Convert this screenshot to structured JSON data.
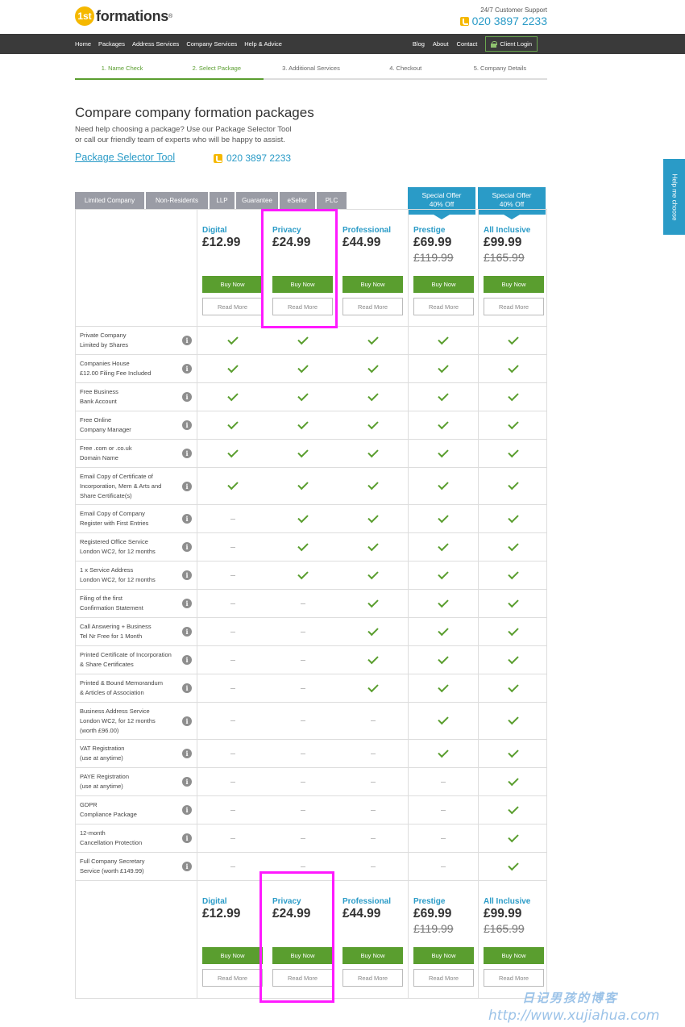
{
  "header": {
    "logo_mark": "1st",
    "logo_text": "formations",
    "logo_reg": "®",
    "support_label": "24/7 Customer Support",
    "support_phone": "020 3897 2233"
  },
  "nav": {
    "left": [
      "Home",
      "Packages",
      "Address Services",
      "Company Services",
      "Help & Advice"
    ],
    "right": [
      "Blog",
      "About",
      "Contact"
    ],
    "client_login": "Client Login"
  },
  "steps": [
    {
      "label": "1. Name Check",
      "done": true
    },
    {
      "label": "2. Select Package",
      "done": true
    },
    {
      "label": "3. Additional Services",
      "done": false
    },
    {
      "label": "4. Checkout",
      "done": false
    },
    {
      "label": "5. Company Details",
      "done": false
    }
  ],
  "intro": {
    "title": "Compare company formation packages",
    "line1": "Need help choosing a package? Use our Package Selector Tool",
    "line2": "or call our friendly team of experts who will be happy to assist.",
    "selector_link": "Package Selector Tool",
    "phone": "020 3897 2233"
  },
  "tabs": [
    "Limited Company",
    "Non-Residents",
    "LLP",
    "Guarantee",
    "eSeller",
    "PLC"
  ],
  "offer": {
    "line1": "Special Offer",
    "line2": "40% Off"
  },
  "packages": [
    {
      "name": "Digital",
      "price": "£12.99",
      "old_price": "",
      "buy": "Buy Now",
      "more": "Read More"
    },
    {
      "name": "Privacy",
      "price": "£24.99",
      "old_price": "",
      "buy": "Buy Now",
      "more": "Read More"
    },
    {
      "name": "Professional",
      "price": "£44.99",
      "old_price": "",
      "buy": "Buy Now",
      "more": "Read More"
    },
    {
      "name": "Prestige",
      "price": "£69.99",
      "old_price": "£119.99",
      "buy": "Buy Now",
      "more": "Read More"
    },
    {
      "name": "All Inclusive",
      "price": "£99.99",
      "old_price": "£165.99",
      "buy": "Buy Now",
      "more": "Read More"
    }
  ],
  "features": [
    {
      "lines": [
        "Private Company",
        "Limited by Shares"
      ],
      "marks": [
        1,
        1,
        1,
        1,
        1
      ]
    },
    {
      "lines": [
        "Companies House",
        "£12.00 Filing Fee Included"
      ],
      "marks": [
        1,
        1,
        1,
        1,
        1
      ]
    },
    {
      "lines": [
        "Free Business",
        "Bank Account"
      ],
      "marks": [
        1,
        1,
        1,
        1,
        1
      ]
    },
    {
      "lines": [
        "Free Online",
        "Company Manager"
      ],
      "marks": [
        1,
        1,
        1,
        1,
        1
      ]
    },
    {
      "lines": [
        "Free .com or .co.uk",
        "Domain Name"
      ],
      "marks": [
        1,
        1,
        1,
        1,
        1
      ]
    },
    {
      "lines": [
        "Email Copy of Certificate of",
        "Incorporation, Mem & Arts and",
        "Share Certificate(s)"
      ],
      "marks": [
        1,
        1,
        1,
        1,
        1
      ]
    },
    {
      "lines": [
        "Email Copy of Company",
        "Register with First Entries"
      ],
      "marks": [
        0,
        1,
        1,
        1,
        1
      ]
    },
    {
      "lines": [
        "Registered Office Service",
        "London WC2, for 12 months"
      ],
      "marks": [
        0,
        1,
        1,
        1,
        1
      ]
    },
    {
      "lines": [
        "1 x Service Address",
        "London WC2, for 12 months"
      ],
      "marks": [
        0,
        1,
        1,
        1,
        1
      ]
    },
    {
      "lines": [
        "Filing of the first",
        "Confirmation Statement"
      ],
      "marks": [
        0,
        0,
        1,
        1,
        1
      ]
    },
    {
      "lines": [
        "Call Answering + Business",
        "Tel Nr Free for 1 Month"
      ],
      "marks": [
        0,
        0,
        1,
        1,
        1
      ]
    },
    {
      "lines": [
        "Printed Certificate of Incorporation",
        "& Share Certificates"
      ],
      "marks": [
        0,
        0,
        1,
        1,
        1
      ]
    },
    {
      "lines": [
        "Printed & Bound Memorandum",
        "& Articles of Association"
      ],
      "marks": [
        0,
        0,
        1,
        1,
        1
      ]
    },
    {
      "lines": [
        "Business Address Service",
        "London WC2, for 12 months",
        "(worth £96.00)"
      ],
      "marks": [
        0,
        0,
        0,
        1,
        1
      ]
    },
    {
      "lines": [
        "VAT Registration",
        "(use at anytime)"
      ],
      "marks": [
        0,
        0,
        0,
        1,
        1
      ]
    },
    {
      "lines": [
        "PAYE Registration",
        "(use at anytime)"
      ],
      "marks": [
        0,
        0,
        0,
        0,
        1
      ]
    },
    {
      "lines": [
        "GDPR",
        "Compliance Package"
      ],
      "marks": [
        0,
        0,
        0,
        0,
        1
      ]
    },
    {
      "lines": [
        "12-month",
        "Cancellation Protection"
      ],
      "marks": [
        0,
        0,
        0,
        0,
        1
      ]
    },
    {
      "lines": [
        "Full Company Secretary",
        "Service (worth £149.99)"
      ],
      "marks": [
        0,
        0,
        0,
        0,
        1
      ]
    }
  ],
  "info_icon": "i",
  "side_tab": "Help me choose",
  "watermark": {
    "line1": "日记男孩的博客",
    "line2": "http://www.xujiahua.com"
  },
  "colors": {
    "accent_blue": "#2a9bc7",
    "green": "#5a9e2f",
    "highlight": "#ff1aff",
    "nav_bg": "#3a3a3a",
    "tab_grey": "#9a9ca5"
  }
}
